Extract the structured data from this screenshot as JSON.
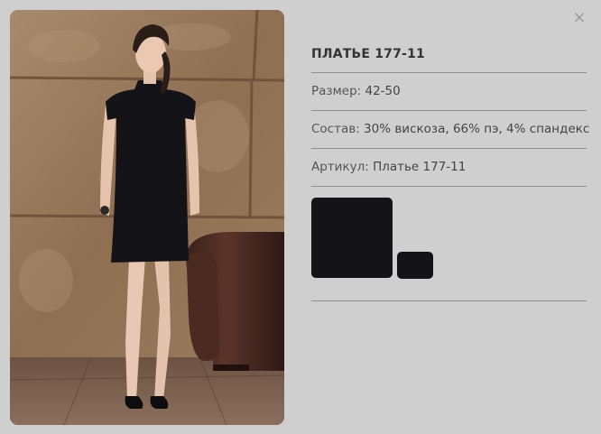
{
  "product": {
    "title": "ПЛАТЬЕ 177-11",
    "size_label": "Размер:",
    "size_value": "42-50",
    "composition_label": "Состав:",
    "composition_value": "30% вискоза, 66% пэ, 4% спандекс",
    "article_label": "Артикул:",
    "article_value": "Платье 177-11"
  },
  "close": {
    "glyph": "×",
    "icon": "close-icon"
  },
  "swatches": [
    {
      "name": "black",
      "color": "#141318"
    },
    {
      "name": "black",
      "color": "#141318"
    }
  ],
  "colors": {
    "background": "#cfcfcf",
    "divider": "#8d8d8d",
    "dress": "#141318"
  }
}
